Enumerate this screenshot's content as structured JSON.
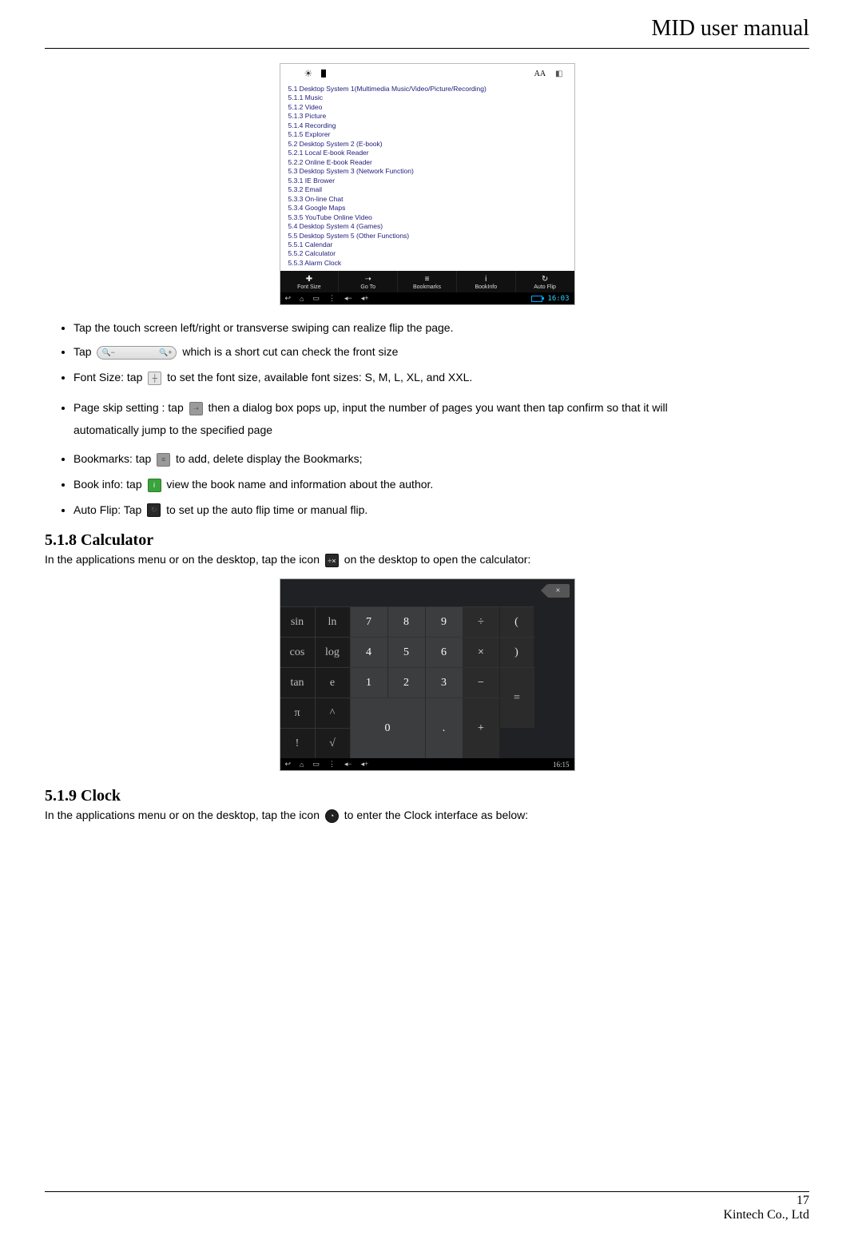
{
  "header": {
    "title": "MID user manual"
  },
  "footer": {
    "page": "17",
    "company": "Kintech Co., Ltd"
  },
  "reader_screenshot": {
    "top_icons": {
      "brightness": "☀",
      "aa": "AA"
    },
    "toc": [
      "5.1 Desktop System 1(Multimedia Music/Video/Picture/Recording)",
      "5.1.1 Music",
      "5.1.2 Video",
      "5.1.3 Picture",
      "5.1.4 Recording",
      "5.1.5 Explorer",
      "5.2 Desktop System 2 (E-book)",
      "5.2.1 Local E-book Reader",
      "5.2.2 Online E-book Reader",
      "5.3 Desktop System 3 (Network Function)",
      "5.3.1 IE Brower",
      "5.3.2 Email",
      "5.3.3 On-line Chat",
      "5.3.4 Google Maps",
      "5.3.5 YouTube Online Video",
      "5.4 Desktop System 4 (Games)",
      "5.5 Desktop System 5 (Other Functions)",
      "5.5.1 Calendar",
      "5.5.2 Calculator",
      "5.5.3 Alarm Clock"
    ],
    "toolbar": [
      {
        "icon": "✚",
        "label": "Font Size"
      },
      {
        "icon": "➝",
        "label": "Go To"
      },
      {
        "icon": "≡",
        "label": "Bookmarks"
      },
      {
        "icon": "i",
        "label": "BookInfo"
      },
      {
        "icon": "↻",
        "label": "Auto Flip"
      }
    ],
    "nav": {
      "clock": "16:03"
    }
  },
  "bullets": {
    "b0": "Tap the touch screen left/right or transverse swiping can realize flip the page.",
    "b1_a": "Tap",
    "b1_b": "which is a short cut can check the front size",
    "b2_a": "Font Size: tap",
    "b2_b": "to set the font size, available font sizes: S, M, L, XL, and XXL.",
    "b3_a": "Page skip setting : tap",
    "b3_b": "then a dialog box pops up, input the number of pages you want then tap confirm so that it will",
    "b3_c": "automatically jump to the specified page",
    "b4_a": "Bookmarks: tap",
    "b4_b": "to add, delete display the Bookmarks;",
    "b5_a": "Book info: tap",
    "b5_b": "view the book name and information about the author.",
    "b6_a": "Auto Flip: Tap",
    "b6_b": "to set up the auto flip time or manual flip."
  },
  "sec_calc": {
    "heading": "5.1.8 Calculator",
    "para_a": "In the applications menu or on the desktop, tap the icon",
    "para_b": "on the desktop to open the calculator:"
  },
  "calc_screenshot": {
    "del_glyph": "×",
    "keys": {
      "sci": [
        "sin",
        "ln",
        "cos",
        "log",
        "tan",
        "e",
        "π",
        "^",
        "!",
        "√"
      ],
      "num": [
        "7",
        "8",
        "9",
        "4",
        "5",
        "6",
        "1",
        "2",
        "3",
        "0",
        "."
      ],
      "ops": [
        "÷",
        "(",
        "×",
        ")",
        "−",
        "+"
      ],
      "eq": "="
    },
    "nav_clock": "16:15"
  },
  "sec_clock": {
    "heading": "5.1.9 Clock",
    "para_a": "In the applications menu or on the desktop, tap the icon",
    "para_b": "to enter the Clock interface as below:"
  }
}
